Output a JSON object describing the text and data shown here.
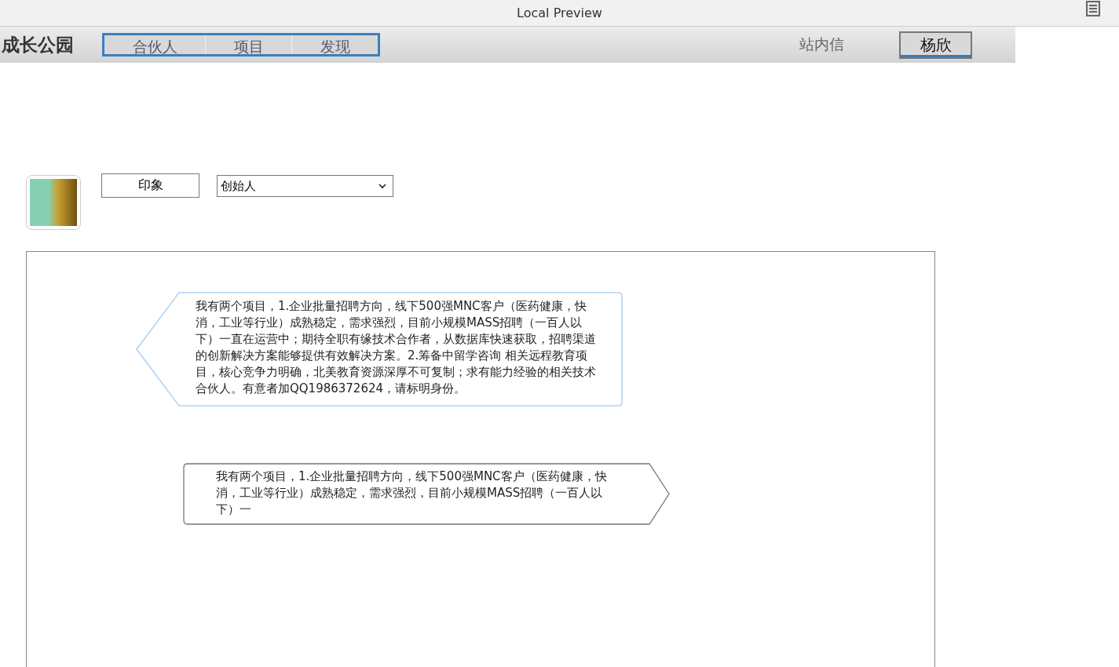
{
  "window": {
    "title": "Local Preview"
  },
  "navbar": {
    "brand": "成长公园",
    "tabs": [
      {
        "label": "合伙人"
      },
      {
        "label": "项目"
      },
      {
        "label": "发现"
      }
    ],
    "messages_link": "站内信",
    "user_button": "杨欣"
  },
  "profile": {
    "impression_button": "印象",
    "role_select": {
      "value": "创始人"
    }
  },
  "messages": [
    {
      "kind": "incoming",
      "text": "我有两个项目，1.企业批量招聘方向，线下500强MNC客户（医药健康，快消，工业等行业）成熟稳定，需求强烈，目前小规模MASS招聘（一百人以下）一直在运营中；期待全职有缘技术合作者，从数据库快速获取，招聘渠道的创新解决方案能够提供有效解决方案。2.筹备中留学咨询 相关远程教育项目，核心竞争力明确，北美教育资源深厚不可复制；求有能力经验的相关技术合伙人。有意者加QQ1986372624，请标明身份。"
    },
    {
      "kind": "outgoing",
      "text": "我有两个项目，1.企业批量招聘方向，线下500强MNC客户（医药健康，快消，工业等行业）成熟稳定，需求强烈，目前小规模MASS招聘（一百人以下）一"
    }
  ]
}
